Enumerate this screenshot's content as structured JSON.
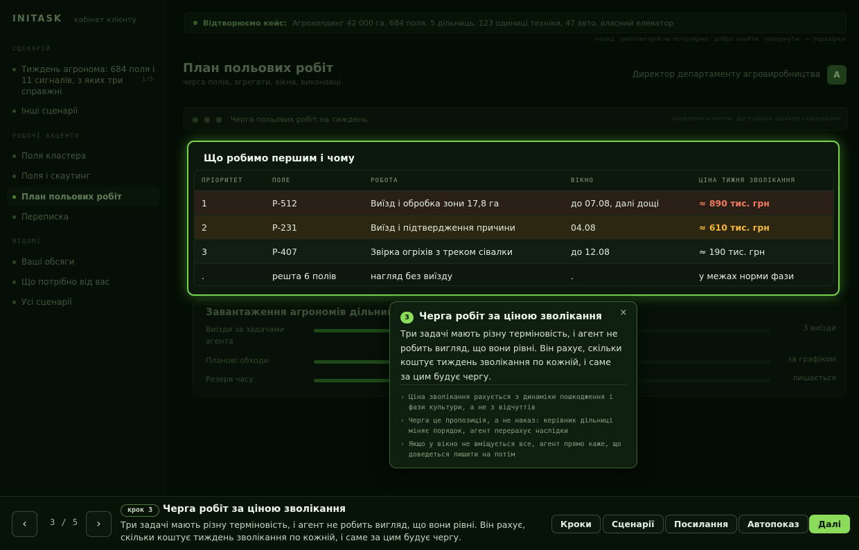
{
  "sidebar": {
    "brand": "INITASK",
    "brand_sub": "кабінет клієнту",
    "section1": "СЦЕНАРІЙ",
    "scenario_items": [
      {
        "label": "Тиждень агронома: 684 поля і 11 сигналів, з яких три справжні"
      },
      {
        "label": "Інші сценарії"
      }
    ],
    "scenario_badge": "1/5",
    "section2": "РОБОЧІ АКЦЕНТИ",
    "work_items": [
      {
        "label": "Поля кластера"
      },
      {
        "label": "Поля і скаутинг"
      },
      {
        "label": "План польових робіт"
      },
      {
        "label": "Переписка"
      }
    ],
    "section3": "ВІДОМІ",
    "known_items": [
      {
        "label": "Ваші обсяги"
      },
      {
        "label": "Що потрібно від вас"
      },
      {
        "label": "Усі сценарії"
      }
    ]
  },
  "header": {
    "alert_label": "Відтворюємо кейс:",
    "alert_text": "Агрохолдинг 42 000 га, 684 поля, 5 дільниць, 123 одиниці техніки, 47 авто, власний елеватор",
    "alert_links": "назад · репозиторій не популярне · добре знайти · повернути · ← перевірка",
    "page_title": "План польових робіт",
    "page_subtitle": "черга полів, агрегати, вікна, виконавці",
    "role": "Директор департаменту агровиробництва",
    "avatar": "A",
    "bar_title": "Черга польових робіт на тиждень",
    "bar_right": "оновлено агентом, достовірно шляхом сканування"
  },
  "card": {
    "title": "Що робимо першим і чому",
    "columns": [
      "ПРІОРИТЕТ",
      "ПОЛЕ",
      "РОБОТА",
      "ВІКНО",
      "ЦІНА ТИЖНЯ ЗВОЛІКАННЯ"
    ],
    "rows": [
      {
        "priority": "1",
        "field": "Р-512",
        "work": "Виїзд і обробка зони 17,8 га",
        "window": "до 07.08, далі дощі",
        "cost": "≈ 890 тис. грн"
      },
      {
        "priority": "2",
        "field": "Р-231",
        "work": "Виїзд і підтвердження причини",
        "window": "04.08",
        "cost": "≈ 610 тис. грн"
      },
      {
        "priority": "3",
        "field": "Р-407",
        "work": "Звірка огріхів з треком сівалки",
        "window": "до 12.08",
        "cost": "≈ 190 тис. грн"
      },
      {
        "priority": ".",
        "field": "решта 6 полів",
        "work": "нагляд без виїзду",
        "window": ".",
        "cost": "у межах норми фази"
      }
    ],
    "colors": {
      "urgent": "#f07a5d",
      "warning": "#f2b63a",
      "accent": "#79d34e"
    }
  },
  "load": {
    "title": "Завантаження агрономів дільниці",
    "rows": [
      {
        "label": "Виїзди за задачами агента",
        "value": "3 виїзди",
        "fill_fraction": 0.55
      },
      {
        "label": "Планові обходи",
        "value": "за графіком",
        "fill_fraction": 0.7
      },
      {
        "label": "Резерв часу",
        "value": "лишається",
        "fill_fraction": 0.3
      }
    ]
  },
  "tooltip": {
    "step_num": "3",
    "title": "Черга робіт за ціною зволікання",
    "close_icon": "×",
    "body": "Три задачі мають різну терміновість, і агент не робить вигляд, що вони рівні. Він рахує, скільки коштує тиждень зволікання по кожній, і саме за цим будує чергу.",
    "notes": [
      "Ціна зволікання рахується з динаміки пошкодження і фази культури, а не з відчуттів",
      "Черга це пропозиція, а не наказ: керівник дільниці міняє порядок, агент перерахує наслідки",
      "Якщо у вікно не вміщується все, агент прямо каже, що доведеться лишити на потім"
    ]
  },
  "bottom": {
    "prev_icon": "‹",
    "next_icon": "›",
    "counter": "3 / 5",
    "step_pill": "крок 3",
    "title": "Черга робіт за ціною зволікання",
    "description": "Три задачі мають різну терміновість, і агент не робить вигляд, що вони рівні. Він рахує, скільки коштує тиждень зволікання по кожній, і саме за цим будує чергу.",
    "buttons": {
      "steps": "Кроки",
      "scenarios": "Сценарії",
      "links": "Посилання",
      "autoplay": "Автопоказ",
      "next": "Далі"
    }
  }
}
